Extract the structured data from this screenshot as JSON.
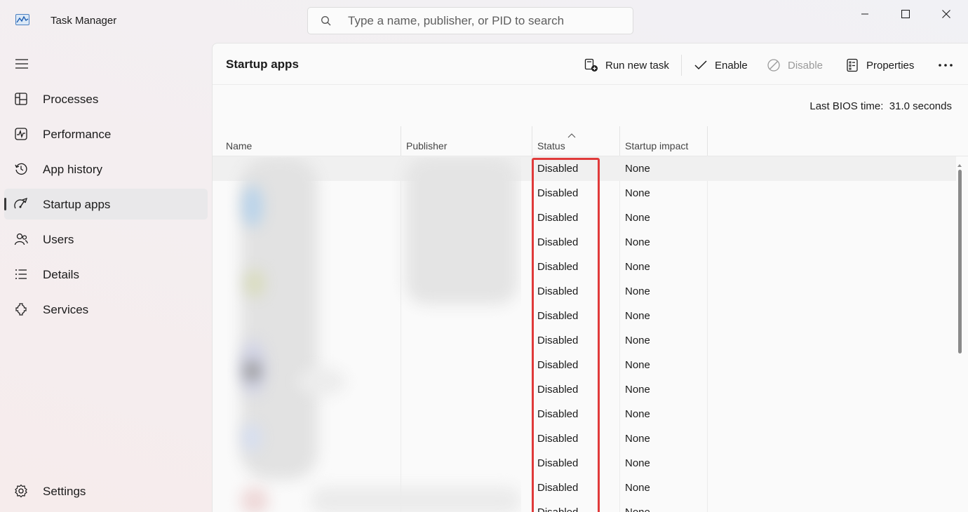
{
  "window": {
    "title": "Task Manager",
    "search_placeholder": "Type a name, publisher, or PID to search"
  },
  "sidebar": {
    "items": [
      {
        "label": "Processes",
        "icon": "processes-icon"
      },
      {
        "label": "Performance",
        "icon": "performance-icon"
      },
      {
        "label": "App history",
        "icon": "history-icon"
      },
      {
        "label": "Startup apps",
        "icon": "startup-icon",
        "active": true
      },
      {
        "label": "Users",
        "icon": "users-icon"
      },
      {
        "label": "Details",
        "icon": "details-icon"
      },
      {
        "label": "Services",
        "icon": "services-icon"
      }
    ],
    "settings_label": "Settings"
  },
  "main": {
    "title": "Startup apps",
    "toolbar": {
      "run_new_task": "Run new task",
      "enable": "Enable",
      "disable": "Disable",
      "properties": "Properties"
    },
    "bios_label": "Last BIOS time:",
    "bios_value": "31.0 seconds",
    "columns": {
      "name": "Name",
      "publisher": "Publisher",
      "status": "Status",
      "impact": "Startup impact"
    },
    "rows": [
      {
        "status": "Disabled",
        "impact": "None"
      },
      {
        "status": "Disabled",
        "impact": "None"
      },
      {
        "status": "Disabled",
        "impact": "None"
      },
      {
        "status": "Disabled",
        "impact": "None"
      },
      {
        "status": "Disabled",
        "impact": "None"
      },
      {
        "status": "Disabled",
        "impact": "None"
      },
      {
        "status": "Disabled",
        "impact": "None"
      },
      {
        "status": "Disabled",
        "impact": "None"
      },
      {
        "status": "Disabled",
        "impact": "None"
      },
      {
        "status": "Disabled",
        "impact": "None"
      },
      {
        "status": "Disabled",
        "impact": "None"
      },
      {
        "status": "Disabled",
        "impact": "None"
      },
      {
        "status": "Disabled",
        "impact": "None"
      },
      {
        "status": "Disabled",
        "impact": "None"
      },
      {
        "status": "Disabled",
        "impact": "None"
      }
    ]
  },
  "colors": {
    "highlight": "#e03a3a",
    "sidebar_active": "#e9e8ea"
  }
}
